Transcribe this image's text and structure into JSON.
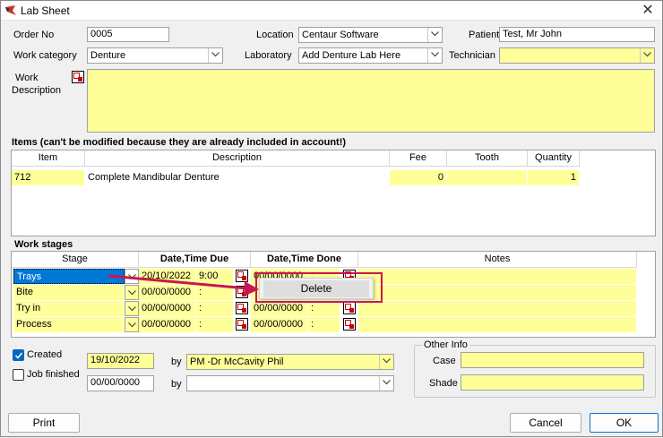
{
  "window": {
    "title": "Lab Sheet"
  },
  "header": {
    "order_no_label": "Order No",
    "order_no": "0005",
    "location_label": "Location",
    "location": "Centaur Software",
    "patient_label": "Patient",
    "patient": "Test, Mr John",
    "work_category_label": "Work category",
    "work_category": "Denture",
    "laboratory_label": "Laboratory",
    "laboratory": "Add Denture Lab Here",
    "technician_label": "Technician",
    "technician": "",
    "work_description_label_1": "Work",
    "work_description_label_2": "Description",
    "work_description": ""
  },
  "items": {
    "title": "Items (can't be modified because they are already included in account!)",
    "columns": [
      "Item",
      "Description",
      "Fee",
      "Tooth",
      "Quantity"
    ],
    "rows": [
      {
        "item": "712",
        "description": "Complete Mandibular Denture",
        "fee": "0",
        "tooth": "",
        "quantity": "1"
      }
    ]
  },
  "stages": {
    "title": "Work stages",
    "columns": [
      "Stage",
      "Date,Time Due",
      "Date,Time Done",
      "Notes"
    ],
    "rows": [
      {
        "stage": "Trays",
        "due_date": "20/10/2022",
        "due_time": "9:00",
        "done_date": "00/00/0000",
        "done_time": ":"
      },
      {
        "stage": "Bite",
        "due_date": "00/00/0000",
        "due_time": ":",
        "done_date": "",
        "done_time": ""
      },
      {
        "stage": "Try in",
        "due_date": "00/00/0000",
        "due_time": ":",
        "done_date": "00/00/0000",
        "done_time": ":"
      },
      {
        "stage": "Process",
        "due_date": "00/00/0000",
        "due_time": ":",
        "done_date": "00/00/0000",
        "done_time": ":"
      }
    ]
  },
  "context_menu": {
    "delete_label": "Delete"
  },
  "status": {
    "created_label": "Created",
    "created_date": "19/10/2022",
    "by_label": "by",
    "created_by": "PM -Dr McCavity Phil",
    "job_finished_label": "Job finished",
    "finished_date": "00/00/0000",
    "finished_by": ""
  },
  "other_info": {
    "title": "Other Info",
    "case_label": "Case",
    "case": "",
    "shade_label": "Shade",
    "shade": ""
  },
  "buttons": {
    "print": "Print",
    "cancel": "Cancel",
    "ok": "OK"
  },
  "colors": {
    "field_yellow": "#ffff99",
    "selection_blue": "#0078d7",
    "annotation_red": "#c8174e"
  }
}
